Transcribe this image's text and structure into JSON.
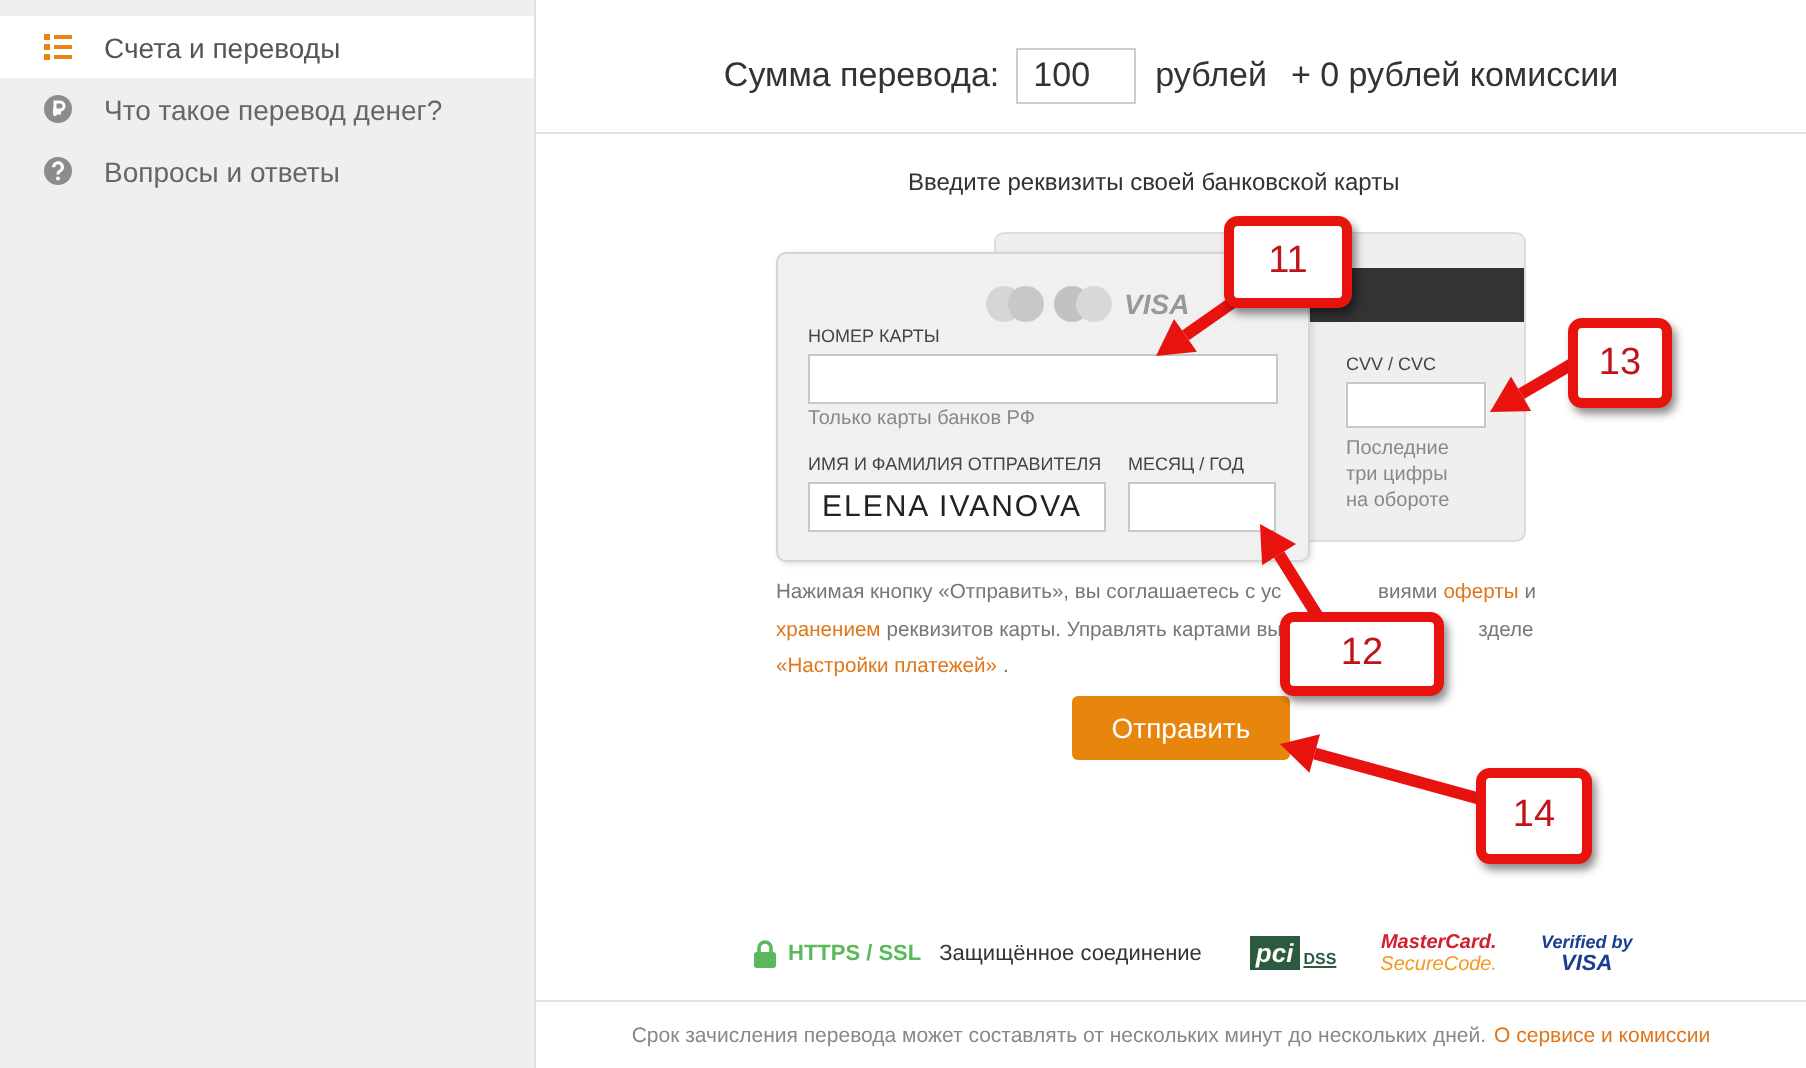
{
  "sidebar": {
    "items": [
      {
        "label": "Счета и переводы",
        "selected": true
      },
      {
        "label": "Что такое перевод денег?",
        "selected": false
      },
      {
        "label": "Вопросы и ответы",
        "selected": false
      }
    ]
  },
  "amount": {
    "label": "Сумма перевода:",
    "value": "100",
    "currency": "рублей",
    "commission": "+ 0 рублей комиссии"
  },
  "card_form": {
    "title": "Введите реквизиты своей банковской карты",
    "front_logo_text": "VISA",
    "card_number": {
      "label": "НОМЕР КАРТЫ",
      "hint": "Только карты банков РФ"
    },
    "holder": {
      "label": "ИМЯ И ФАМИЛИЯ ОТПРАВИТЕЛЯ",
      "value": "ELENA IVANOVA"
    },
    "expiry": {
      "label": "МЕСЯЦ / ГОД"
    },
    "cvv": {
      "label": "CVV / CVC",
      "hint": "Последние три цифры на обороте"
    }
  },
  "note": {
    "lines": [
      [
        {
          "kind": "text",
          "text": "Нажимая кнопку «Отправить», вы соглашаетесь с ус"
        },
        {
          "kind": "covered"
        },
        {
          "kind": "text",
          "text": "виями"
        },
        {
          "kind": "link",
          "text": "оферты"
        },
        {
          "kind": "text",
          "text": "и"
        }
      ],
      [
        {
          "kind": "link",
          "text": "хранением"
        },
        {
          "kind": "text",
          "text": "реквизитов карты. Управлять картами вы"
        },
        {
          "kind": "covered"
        },
        {
          "kind": "text",
          "text": "зделе"
        }
      ],
      [
        {
          "kind": "link",
          "text": "«Настройки платежей»"
        },
        {
          "kind": "text",
          "text": "."
        }
      ]
    ]
  },
  "submit_button": "Отправить",
  "security": {
    "protocol": "HTTPS / SSL",
    "text": "Защищённое соединение",
    "badges": [
      {
        "kind": "pci",
        "lines": [
          "pci",
          "DSS"
        ]
      },
      {
        "kind": "mastercard",
        "lines": [
          "MasterCard.",
          "SecureCode."
        ]
      },
      {
        "kind": "visa",
        "lines": [
          "Verified by",
          "VISA"
        ]
      }
    ]
  },
  "footer": {
    "text": "Срок зачисления перевода может составлять от нескольких минут до нескольких дней.",
    "link": "О сервисе и комиссии"
  },
  "callouts": [
    {
      "number": "11"
    },
    {
      "number": "12"
    },
    {
      "number": "13"
    },
    {
      "number": "14"
    }
  ]
}
